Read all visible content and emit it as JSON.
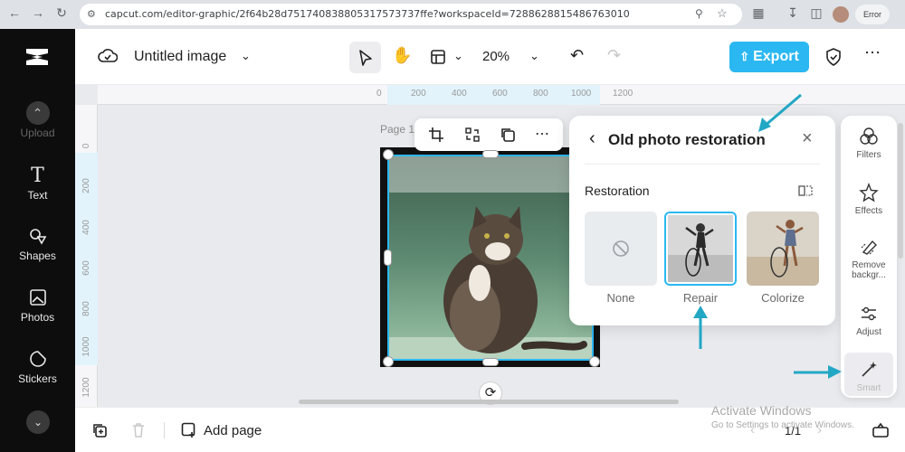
{
  "browser": {
    "url": "capcut.com/editor-graphic/2f64b28d751740838805317573737ffe?workspaceId=7288628815486763010",
    "profile_status": "Error"
  },
  "left_rail": {
    "items": [
      {
        "label": "Upload",
        "icon": "upload-icon"
      },
      {
        "label": "Text",
        "icon": "text-icon"
      },
      {
        "label": "Shapes",
        "icon": "shapes-icon"
      },
      {
        "label": "Photos",
        "icon": "photos-icon"
      },
      {
        "label": "Stickers",
        "icon": "stickers-icon"
      }
    ]
  },
  "toolbar": {
    "title": "Untitled image",
    "zoom": "20%",
    "export_label": "Export"
  },
  "rulers": {
    "top_ticks": [
      "0",
      "200",
      "400",
      "600",
      "800",
      "1000",
      "1200"
    ],
    "left_ticks": [
      "0",
      "200",
      "400",
      "600",
      "800",
      "1000",
      "1200"
    ]
  },
  "canvas": {
    "page_label": "Page 1"
  },
  "restore_panel": {
    "title": "Old photo restoration",
    "section_label": "Restoration",
    "options": [
      {
        "label": "None",
        "selected": false
      },
      {
        "label": "Repair",
        "selected": true
      },
      {
        "label": "Colorize",
        "selected": false
      }
    ]
  },
  "right_rail": {
    "items": [
      {
        "label": "Filters",
        "icon": "filters-icon"
      },
      {
        "label": "Effects",
        "icon": "effects-icon"
      },
      {
        "label": "Remove backgr...",
        "icon": "remove-background-icon"
      },
      {
        "label": "Adjust",
        "icon": "adjust-icon"
      },
      {
        "label": "Smart",
        "icon": "smart-icon"
      }
    ]
  },
  "bottom_bar": {
    "add_page_label": "Add page",
    "page_count": "1/1"
  },
  "watermark": {
    "line1": "Activate Windows",
    "line2": "Go to Settings to activate Windows."
  },
  "colors": {
    "accent": "#2bb8f2",
    "annotation_arrow": "#22a7c4",
    "rail_bg": "#0d0d0d"
  }
}
